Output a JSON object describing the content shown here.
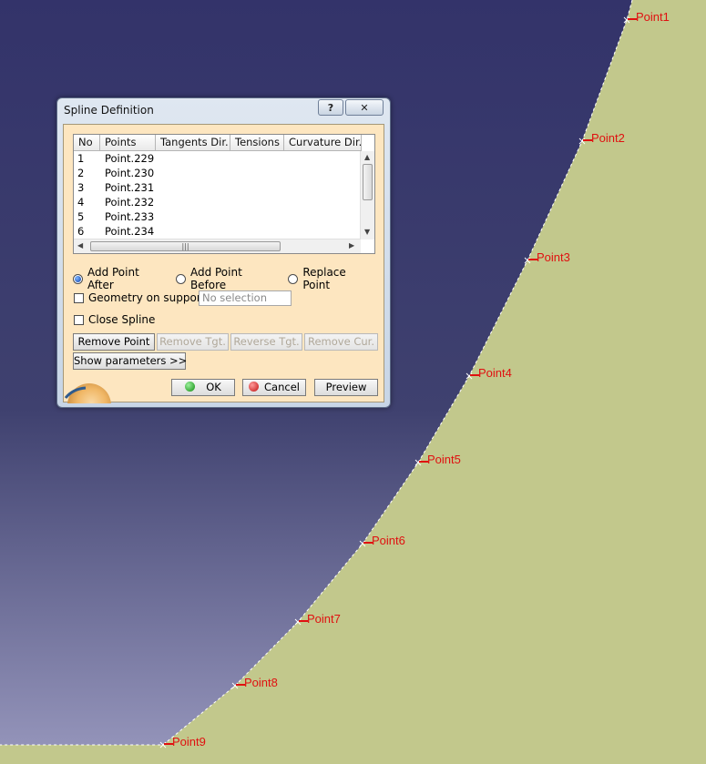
{
  "viewport": {
    "points": [
      "Point1",
      "Point2",
      "Point3",
      "Point4",
      "Point5",
      "Point6",
      "Point7",
      "Point8",
      "Point9"
    ]
  },
  "dialog": {
    "title": "Spline Definition",
    "help_label": "?",
    "close_label": "✕",
    "table": {
      "headers": [
        "No",
        "Points",
        "Tangents Dir.",
        "Tensions",
        "Curvature Dir."
      ],
      "rows": [
        {
          "no": "1",
          "point": "Point.229"
        },
        {
          "no": "2",
          "point": "Point.230"
        },
        {
          "no": "3",
          "point": "Point.231"
        },
        {
          "no": "4",
          "point": "Point.232"
        },
        {
          "no": "5",
          "point": "Point.233"
        },
        {
          "no": "6",
          "point": "Point.234"
        }
      ]
    },
    "radio": {
      "add_after": "Add Point After",
      "add_before": "Add Point Before",
      "replace": "Replace Point",
      "selected": "add_after"
    },
    "geometry_on_support": "Geometry on support",
    "geometry_placeholder": "No selection",
    "close_spline": "Close Spline",
    "buttons": {
      "remove_point": "Remove Point",
      "remove_tgt": "Remove Tgt.",
      "reverse_tgt": "Reverse Tgt.",
      "remove_cur": "Remove Cur.",
      "show_parameters": "Show parameters >>",
      "ok": "OK",
      "cancel": "Cancel",
      "preview": "Preview"
    }
  },
  "colors": {
    "surface_top": "#34346a",
    "surface_bottom": "#8f90b6",
    "ground": "#c2c88c",
    "point_label": "#e01010"
  }
}
